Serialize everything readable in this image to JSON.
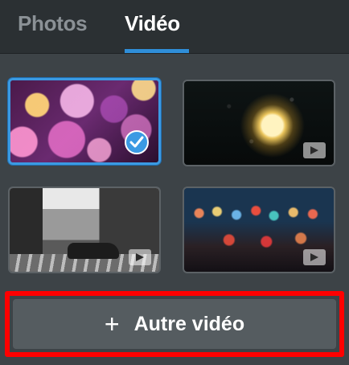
{
  "tabs": {
    "photos_label": "Photos",
    "video_label": "Vidéo",
    "active": "Vidéo"
  },
  "thumbnails": [
    {
      "name": "bokeh-pink",
      "selected": true,
      "icon": "check-icon"
    },
    {
      "name": "rainy-window-light",
      "selected": false,
      "icon": "video-icon"
    },
    {
      "name": "city-street-bw",
      "selected": false,
      "icon": "video-icon"
    },
    {
      "name": "bokeh-city-lights",
      "selected": false,
      "icon": "video-icon"
    }
  ],
  "add_button": {
    "icon": "plus-icon",
    "label": "Autre vidéo"
  },
  "colors": {
    "accent": "#3b9ae3",
    "highlight": "#ff0000",
    "background": "#3d4347"
  }
}
